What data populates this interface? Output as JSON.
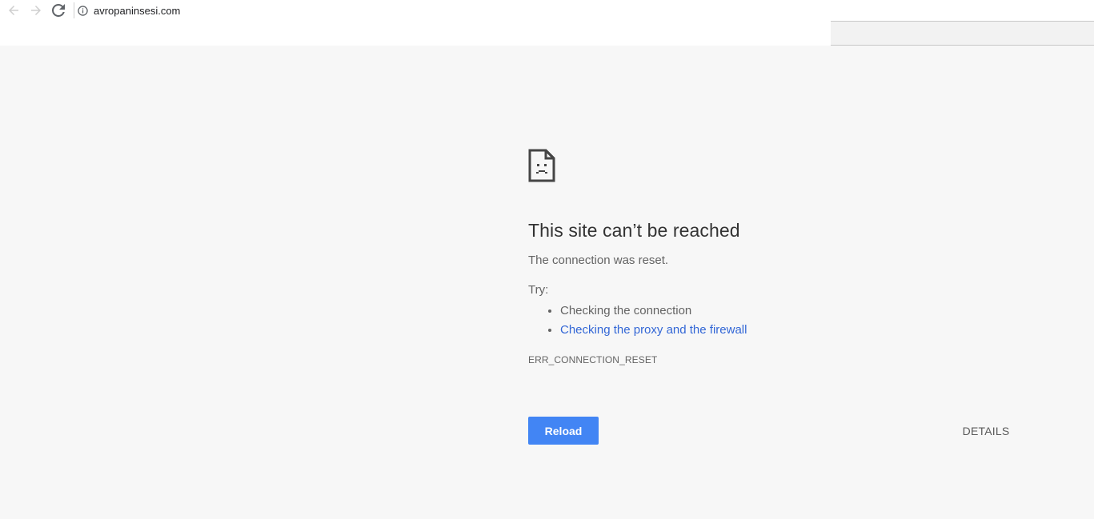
{
  "browser": {
    "url": "avropaninsesi.com",
    "icons": {
      "back": "arrow-left-icon",
      "forward": "arrow-right-icon",
      "reload": "reload-icon",
      "site_info": "info-icon"
    }
  },
  "error": {
    "icon": "sad-page-icon",
    "title": "This site can’t be reached",
    "description": "The connection was reset.",
    "try_label": "Try:",
    "suggestions": [
      "Checking the connection",
      "Checking the proxy and the firewall"
    ],
    "code": "ERR_CONNECTION_RESET",
    "reload_label": "Reload",
    "details_label": "DETAILS"
  },
  "colors": {
    "page_background": "#f7f7f7",
    "button_blue": "#4285f4",
    "link_blue": "#3367d6",
    "title_text": "#333333",
    "body_text": "#646464"
  }
}
